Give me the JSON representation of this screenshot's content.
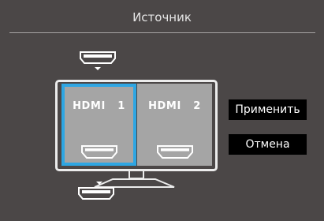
{
  "dialog": {
    "title": "Источник"
  },
  "sources": [
    {
      "label": "HDMI   1",
      "icon": "hdmi-port-icon",
      "selected": true
    },
    {
      "label": "HDMI   2",
      "icon": "hdmi-port-icon",
      "selected": false
    }
  ],
  "buttons": {
    "apply_label": "Применить",
    "cancel_label": "Отмена"
  },
  "colors": {
    "background": "#4b4747",
    "tile": "#a5a5a5",
    "selection": "#2ea6e3",
    "button": "#000000",
    "text": "#ffffff"
  }
}
